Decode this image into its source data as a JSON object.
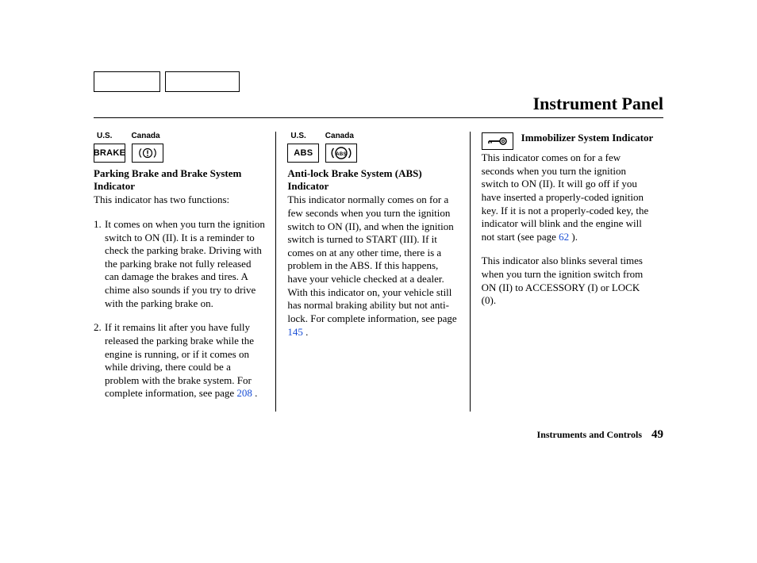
{
  "header": {
    "pageTitle": "Instrument Panel"
  },
  "col1": {
    "labelUS": "U.S.",
    "labelCanada": "Canada",
    "iconUS": "BRAKE",
    "heading": "Parking Brake and Brake System Indicator",
    "intro": "This indicator has two functions:",
    "items": [
      {
        "num": "1.",
        "text": "It comes on when you turn the ignition switch to ON (II). It is a reminder to check the parking brake. Driving with the parking brake not fully released can damage the brakes and tires. A chime also sounds if you try to drive with the parking brake on."
      },
      {
        "num": "2.",
        "textPrefix": "If it remains lit after you have fully released the parking brake while the engine is running, or if it comes on while driving, there could be a problem with the brake system. For complete information, see page ",
        "link": "208",
        "textSuffix": " ."
      }
    ]
  },
  "col2": {
    "labelUS": "U.S.",
    "labelCanada": "Canada",
    "iconUS": "ABS",
    "heading": "Anti-lock Brake System (ABS) Indicator",
    "bodyPrefix": "This indicator normally comes on for a few seconds when you turn the ignition switch to ON (II), and when the ignition switch is turned to START (III). If it comes on at any other time, there is a problem in the ABS. If this happens, have your vehicle checked at a dealer. With this indicator on, your vehicle still has normal braking ability but not anti-lock. For complete information, see page ",
    "link": "145",
    "bodySuffix": " ."
  },
  "col3": {
    "heading": "Immobilizer System Indicator",
    "body1Prefix": "This indicator comes on for a few seconds when you turn the ignition switch to ON (II). It will go off if you have inserted a properly-coded ignition key. If it is not a properly-coded key, the indicator will blink and the engine will not start (see page ",
    "link": "62",
    "body1Suffix": " ).",
    "body2": "This indicator also blinks several times when you turn the ignition switch from ON (II) to ACCESSORY (I) or LOCK (0)."
  },
  "footer": {
    "section": "Instruments and Controls",
    "page": "49"
  }
}
